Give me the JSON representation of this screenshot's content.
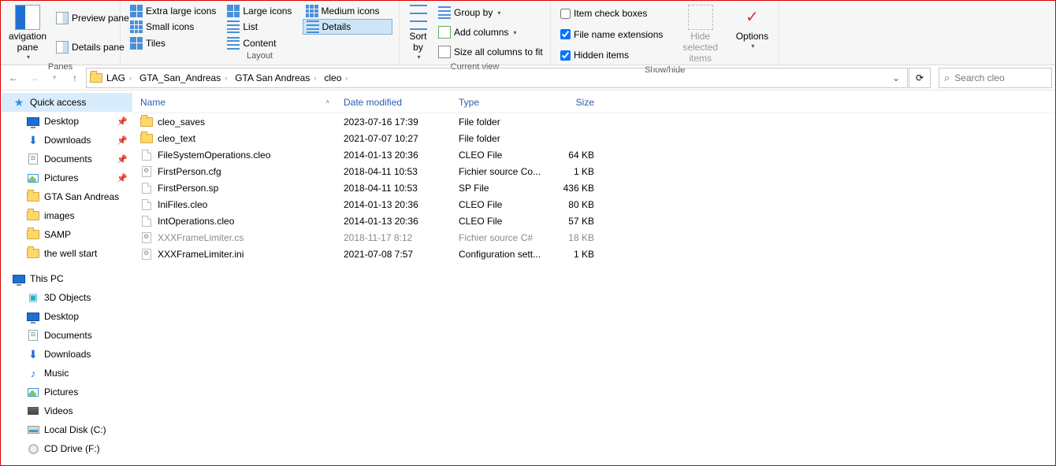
{
  "ribbon": {
    "panes": {
      "title": "Panes",
      "nav_pane": "avigation pane",
      "preview": "Preview pane",
      "details": "Details pane"
    },
    "layout": {
      "title": "Layout",
      "extra_large": "Extra large icons",
      "large": "Large icons",
      "medium": "Medium icons",
      "small": "Small icons",
      "list": "List",
      "details": "Details",
      "tiles": "Tiles",
      "content": "Content"
    },
    "current_view": {
      "title": "Current view",
      "sort_by": "Sort by",
      "group_by": "Group by",
      "add_columns": "Add columns",
      "size_fit": "Size all columns to fit"
    },
    "show_hide": {
      "title": "Show/hide",
      "item_check": "Item check boxes",
      "file_ext": "File name extensions",
      "hidden": "Hidden items",
      "hide_selected": "Hide selected items",
      "options": "Options"
    }
  },
  "breadcrumbs": [
    "LAG",
    "GTA_San_Andreas",
    "GTA San Andreas",
    "cleo"
  ],
  "search_placeholder": "Search cleo",
  "sidebar": {
    "quick_access": "Quick access",
    "qa_items": [
      {
        "label": "Desktop",
        "icon": "mon",
        "pin": true
      },
      {
        "label": "Downloads",
        "icon": "dl",
        "pin": true
      },
      {
        "label": "Documents",
        "icon": "doc",
        "pin": true
      },
      {
        "label": "Pictures",
        "icon": "pic",
        "pin": true
      },
      {
        "label": "GTA San Andreas",
        "icon": "folder",
        "pin": false
      },
      {
        "label": "images",
        "icon": "folder",
        "pin": false
      },
      {
        "label": "SAMP",
        "icon": "folder",
        "pin": false
      },
      {
        "label": "the well start",
        "icon": "folder",
        "pin": false
      }
    ],
    "this_pc": "This PC",
    "pc_items": [
      {
        "label": "3D Objects",
        "icon": "3d"
      },
      {
        "label": "Desktop",
        "icon": "mon"
      },
      {
        "label": "Documents",
        "icon": "doc"
      },
      {
        "label": "Downloads",
        "icon": "dl"
      },
      {
        "label": "Music",
        "icon": "music"
      },
      {
        "label": "Pictures",
        "icon": "pic"
      },
      {
        "label": "Videos",
        "icon": "video"
      },
      {
        "label": "Local Disk (C:)",
        "icon": "disk"
      },
      {
        "label": "CD Drive (F:)",
        "icon": "cd"
      }
    ]
  },
  "columns": {
    "name": "Name",
    "date": "Date modified",
    "type": "Type",
    "size": "Size"
  },
  "files": [
    {
      "icon": "folder",
      "name": "cleo_saves",
      "date": "2023-07-16 17:39",
      "type": "File folder",
      "size": ""
    },
    {
      "icon": "folder",
      "name": "cleo_text",
      "date": "2021-07-07 10:27",
      "type": "File folder",
      "size": ""
    },
    {
      "icon": "file",
      "name": "FileSystemOperations.cleo",
      "date": "2014-01-13 20:36",
      "type": "CLEO File",
      "size": "64 KB"
    },
    {
      "icon": "cfg",
      "name": "FirstPerson.cfg",
      "date": "2018-04-11 10:53",
      "type": "Fichier source Co...",
      "size": "1 KB"
    },
    {
      "icon": "file",
      "name": "FirstPerson.sp",
      "date": "2018-04-11 10:53",
      "type": "SP File",
      "size": "436 KB"
    },
    {
      "icon": "file",
      "name": "IniFiles.cleo",
      "date": "2014-01-13 20:36",
      "type": "CLEO File",
      "size": "80 KB"
    },
    {
      "icon": "file",
      "name": "IntOperations.cleo",
      "date": "2014-01-13 20:36",
      "type": "CLEO File",
      "size": "57 KB"
    },
    {
      "icon": "cfg",
      "name": "XXXFrameLimiter.cs",
      "date": "2018-11-17 8:12",
      "type": "Fichier source C#",
      "size": "18 KB",
      "sel": true
    },
    {
      "icon": "cfg",
      "name": "XXXFrameLimiter.ini",
      "date": "2021-07-08 7:57",
      "type": "Configuration sett...",
      "size": "1 KB"
    }
  ]
}
